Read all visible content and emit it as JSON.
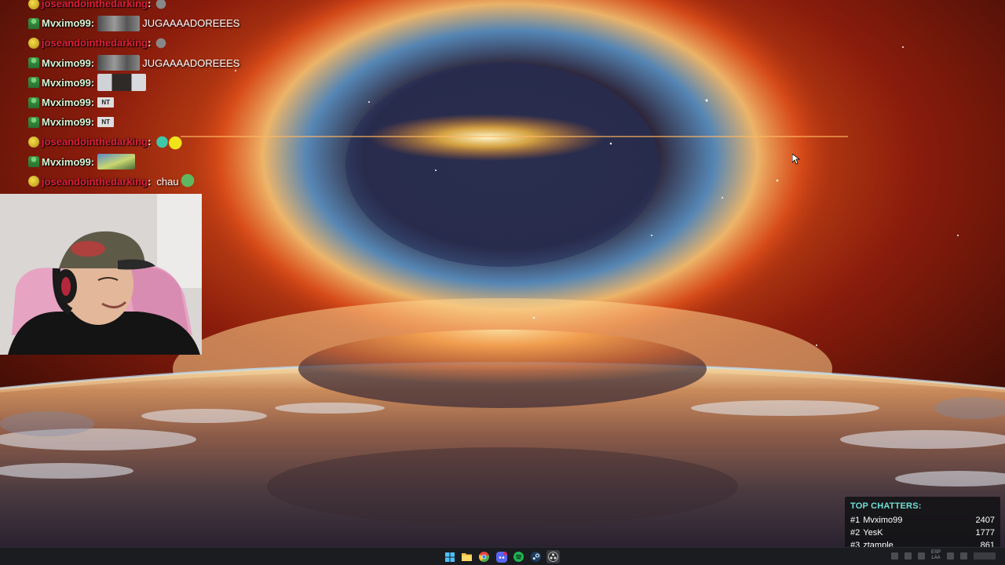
{
  "chat": {
    "messages": [
      {
        "user": "joseandointhedarking",
        "text": "",
        "emote": "ghost"
      },
      {
        "user": "Mvximo99",
        "text": "JUGAAAADOREEES",
        "emote": "banner"
      },
      {
        "user": "joseandointhedarking",
        "text": "",
        "emote": "ghost"
      },
      {
        "user": "Mvximo99",
        "text": "JUGAAAADOREEES",
        "emote": "banner"
      },
      {
        "user": "Mvximo99",
        "text": "",
        "emote": "face"
      },
      {
        "user": "Mvximo99",
        "text": "",
        "emote": "nt"
      },
      {
        "user": "Mvximo99",
        "text": "",
        "emote": "nt"
      },
      {
        "user": "joseandointhedarking",
        "text": "",
        "emote": "frog"
      },
      {
        "user": "Mvximo99",
        "text": "",
        "emote": "scene"
      },
      {
        "user": "joseandointhedarking",
        "text": "chau",
        "emote": "pepe"
      }
    ],
    "emote_nt_label": "NT"
  },
  "top_chatters": {
    "title": "TOP CHATTERS:",
    "rows": [
      {
        "rank": "#1",
        "name": "Mvximo99",
        "count": "2407"
      },
      {
        "rank": "#2",
        "name": "YesK",
        "count": "1777"
      },
      {
        "rank": "#3",
        "name": "ztample",
        "count": "861"
      }
    ]
  },
  "taskbar": {
    "apps": [
      "windows-start-icon",
      "file-explorer-icon",
      "chrome-icon",
      "discord-icon",
      "spotify-icon",
      "steam-icon",
      "obs-icon"
    ],
    "tray_lang": "ESP",
    "tray_lang_sub": "LAA"
  },
  "colors": {
    "mvximo_name": "#d8f6d4",
    "jose_name": "#e0203a",
    "top_chatters_title": "#6fe0d6"
  }
}
